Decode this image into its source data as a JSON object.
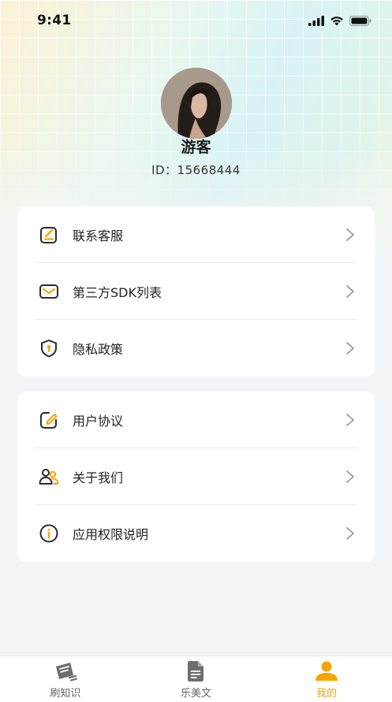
{
  "status_bar": {
    "time": "9:41"
  },
  "profile": {
    "name": "游客",
    "id_text": "ID：15668444"
  },
  "menu_group_1": [
    {
      "label": "联系客服",
      "icon": "edit-note-icon"
    },
    {
      "label": "第三方SDK列表",
      "icon": "envelope-icon"
    },
    {
      "label": "隐私政策",
      "icon": "shield-icon"
    }
  ],
  "menu_group_2": [
    {
      "label": "用户协议",
      "icon": "pencil-square-icon"
    },
    {
      "label": "关于我们",
      "icon": "users-icon"
    },
    {
      "label": "应用权限说明",
      "icon": "info-icon"
    }
  ],
  "tabs": [
    {
      "label": "刷知识",
      "icon": "book-icon",
      "active": false
    },
    {
      "label": "乐美文",
      "icon": "document-icon",
      "active": false
    },
    {
      "label": "我的",
      "icon": "profile-icon",
      "active": true
    }
  ],
  "colors": {
    "accent": "#f5a600",
    "icon_dark": "#2b2b2b",
    "inactive_tab": "#6e6e6e"
  }
}
